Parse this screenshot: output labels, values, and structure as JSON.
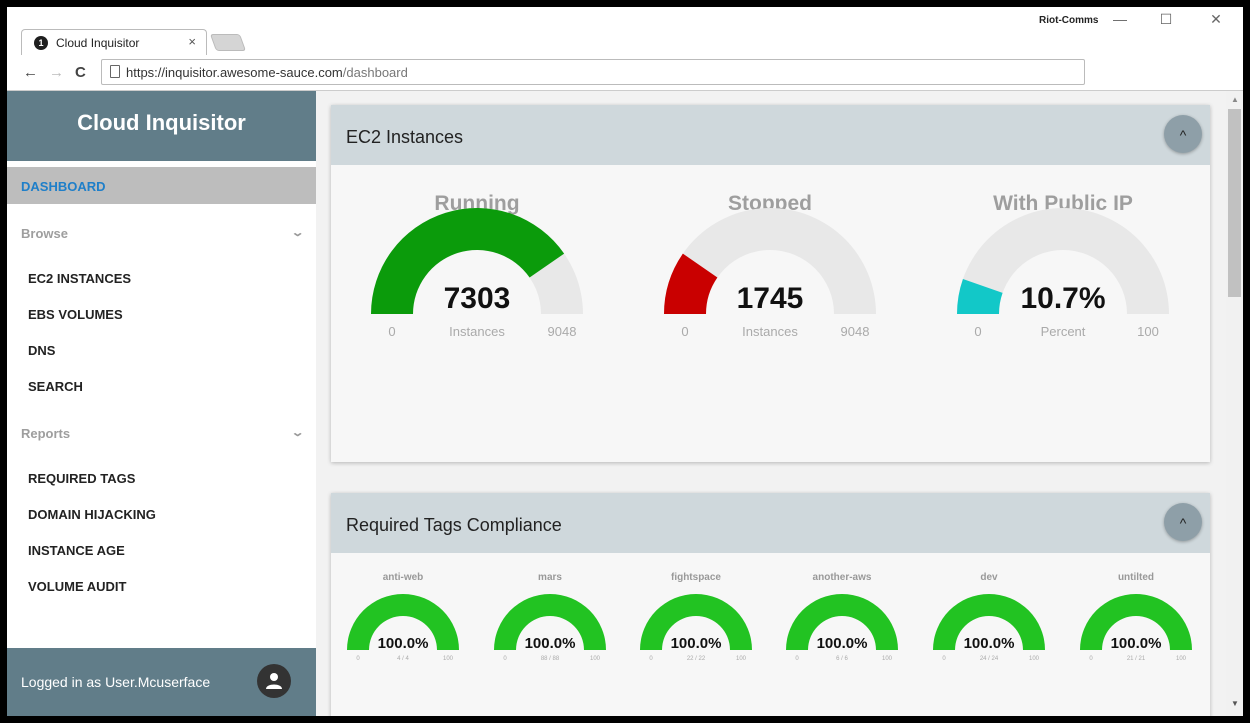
{
  "browser": {
    "tab_title": "Cloud Inquisitor",
    "tab_favicon_text": "1",
    "tab_close": "×",
    "profile": "Riot-Comms",
    "url_host": "https://inquisitor.awesome-sauce.com",
    "url_path": "/dashboard",
    "minimize": "—",
    "maximize": "☐",
    "close": "✕",
    "back": "←",
    "forward": "→",
    "reload": "C"
  },
  "sidebar": {
    "brand": "Cloud Inquisitor",
    "active_item": "DASHBOARD",
    "browse_label": "Browse",
    "browse_items": [
      "EC2 INSTANCES",
      "EBS VOLUMES",
      "DNS",
      "SEARCH"
    ],
    "reports_label": "Reports",
    "reports_items": [
      "REQUIRED TAGS",
      "DOMAIN HIJACKING",
      "INSTANCE AGE",
      "VOLUME AUDIT"
    ],
    "footer": "Logged in as User.Mcuserface",
    "chevron": "⌄"
  },
  "ec2": {
    "title": "EC2 Instances",
    "collapse": "^",
    "gauges": [
      {
        "title": "Running",
        "value": 7303,
        "display": "7303",
        "label": "Instances",
        "min": "0",
        "max": "9048",
        "max_value": 9048,
        "color": "#0b9b0b"
      },
      {
        "title": "Stopped",
        "value": 1745,
        "display": "1745",
        "label": "Instances",
        "min": "0",
        "max": "9048",
        "max_value": 9048,
        "color": "#c90000"
      },
      {
        "title": "With Public IP",
        "value": 10.7,
        "display": "10.7%",
        "label": "Percent",
        "min": "0",
        "max": "100",
        "max_value": 100,
        "color": "#12c8c8"
      }
    ]
  },
  "tags": {
    "title": "Required Tags Compliance",
    "collapse": "^",
    "gauges": [
      {
        "title": "anti-web",
        "percent": 100.0,
        "display": "100.0%",
        "label": "4 / 4",
        "min": "0",
        "max": "100"
      },
      {
        "title": "mars",
        "percent": 100.0,
        "display": "100.0%",
        "label": "88 / 88",
        "min": "0",
        "max": "100"
      },
      {
        "title": "fightspace",
        "percent": 100.0,
        "display": "100.0%",
        "label": "22 / 22",
        "min": "0",
        "max": "100"
      },
      {
        "title": "another-aws",
        "percent": 100.0,
        "display": "100.0%",
        "label": "6 / 6",
        "min": "0",
        "max": "100"
      },
      {
        "title": "dev",
        "percent": 100.0,
        "display": "100.0%",
        "label": "24 / 24",
        "min": "0",
        "max": "100"
      },
      {
        "title": "untilted",
        "percent": 100.0,
        "display": "100.0%",
        "label": "21 / 21",
        "min": "0",
        "max": "100"
      }
    ],
    "color": "#22c322"
  }
}
